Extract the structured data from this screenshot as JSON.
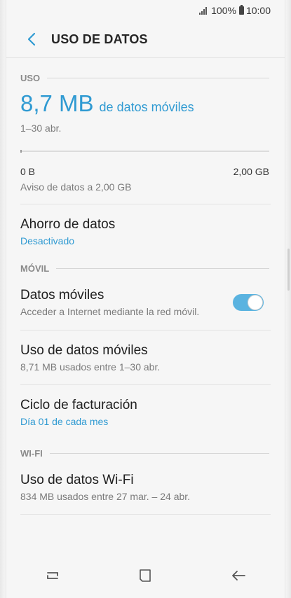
{
  "status": {
    "battery_text": "100%",
    "time": "10:00"
  },
  "header": {
    "title": "USO DE DATOS"
  },
  "usage": {
    "section": "USO",
    "amount": "8,7 MB",
    "unit": "de datos móviles",
    "period": "1–30 abr.",
    "bar_fill_fraction": 0.004,
    "bar_min": "0 B",
    "bar_max": "2,00 GB",
    "warning": "Aviso de datos a 2,00 GB"
  },
  "saver": {
    "title": "Ahorro de datos",
    "status": "Desactivado"
  },
  "mobile": {
    "section": "MÓVIL",
    "data": {
      "title": "Datos móviles",
      "subtitle": "Acceder a Internet mediante la red móvil.",
      "enabled": true
    },
    "usage": {
      "title": "Uso de datos móviles",
      "subtitle": "8,71 MB usados entre 1–30 abr."
    },
    "billing": {
      "title": "Ciclo de facturación",
      "subtitle": "Día 01 de cada mes"
    }
  },
  "wifi": {
    "section": "WI-FI",
    "usage": {
      "title": "Uso de datos Wi-Fi",
      "subtitle": "834 MB usados entre 27 mar. – 24 abr."
    }
  },
  "colors": {
    "accent": "#2f9ad2",
    "toggle_on": "#5ab3e0"
  }
}
